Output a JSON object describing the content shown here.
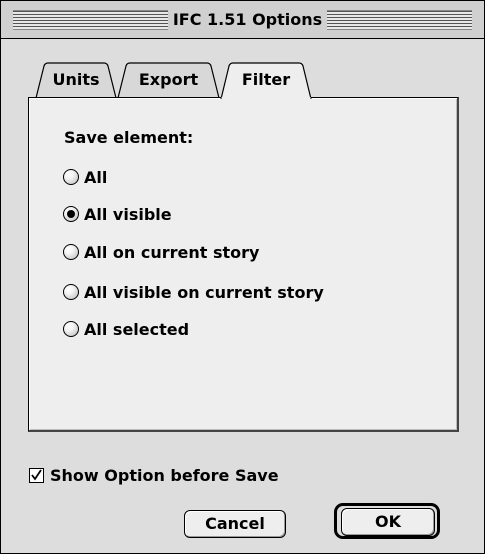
{
  "window": {
    "title": "IFC 1.51 Options"
  },
  "tabs": [
    {
      "label": "Units",
      "active": false
    },
    {
      "label": "Export",
      "active": false
    },
    {
      "label": "Filter",
      "active": true
    }
  ],
  "filter_panel": {
    "section_label": "Save element:",
    "options": [
      {
        "label": "All",
        "selected": false
      },
      {
        "label": "All visible",
        "selected": true
      },
      {
        "label": "All on current story",
        "selected": false
      },
      {
        "label": "All visible on current story",
        "selected": false
      },
      {
        "label": "All selected",
        "selected": false
      }
    ]
  },
  "show_option_checkbox": {
    "label": "Show Option before Save",
    "checked": true
  },
  "buttons": {
    "cancel": "Cancel",
    "ok": "OK"
  }
}
